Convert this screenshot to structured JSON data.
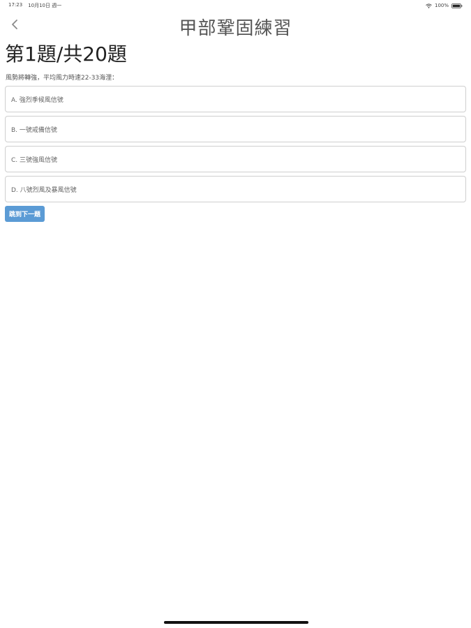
{
  "status_bar": {
    "time": "17:23",
    "date": "10月10日 週一",
    "battery": "100%"
  },
  "nav": {
    "title": "甲部鞏固練習",
    "back_icon": "chevron-left-icon"
  },
  "quiz": {
    "heading": "第1題/共20題",
    "question": "風勢將轉強，平均風力時速22-33海浬：",
    "options": [
      {
        "label": "A. 強烈季候風信號"
      },
      {
        "label": "B. 一號戒備信號"
      },
      {
        "label": "C. 三號強風信號"
      },
      {
        "label": "D. 八號烈風及暴風信號"
      }
    ],
    "skip_label": "跳到下一題"
  },
  "colors": {
    "accent": "#5b9bd5",
    "border": "#cfcfcf"
  }
}
